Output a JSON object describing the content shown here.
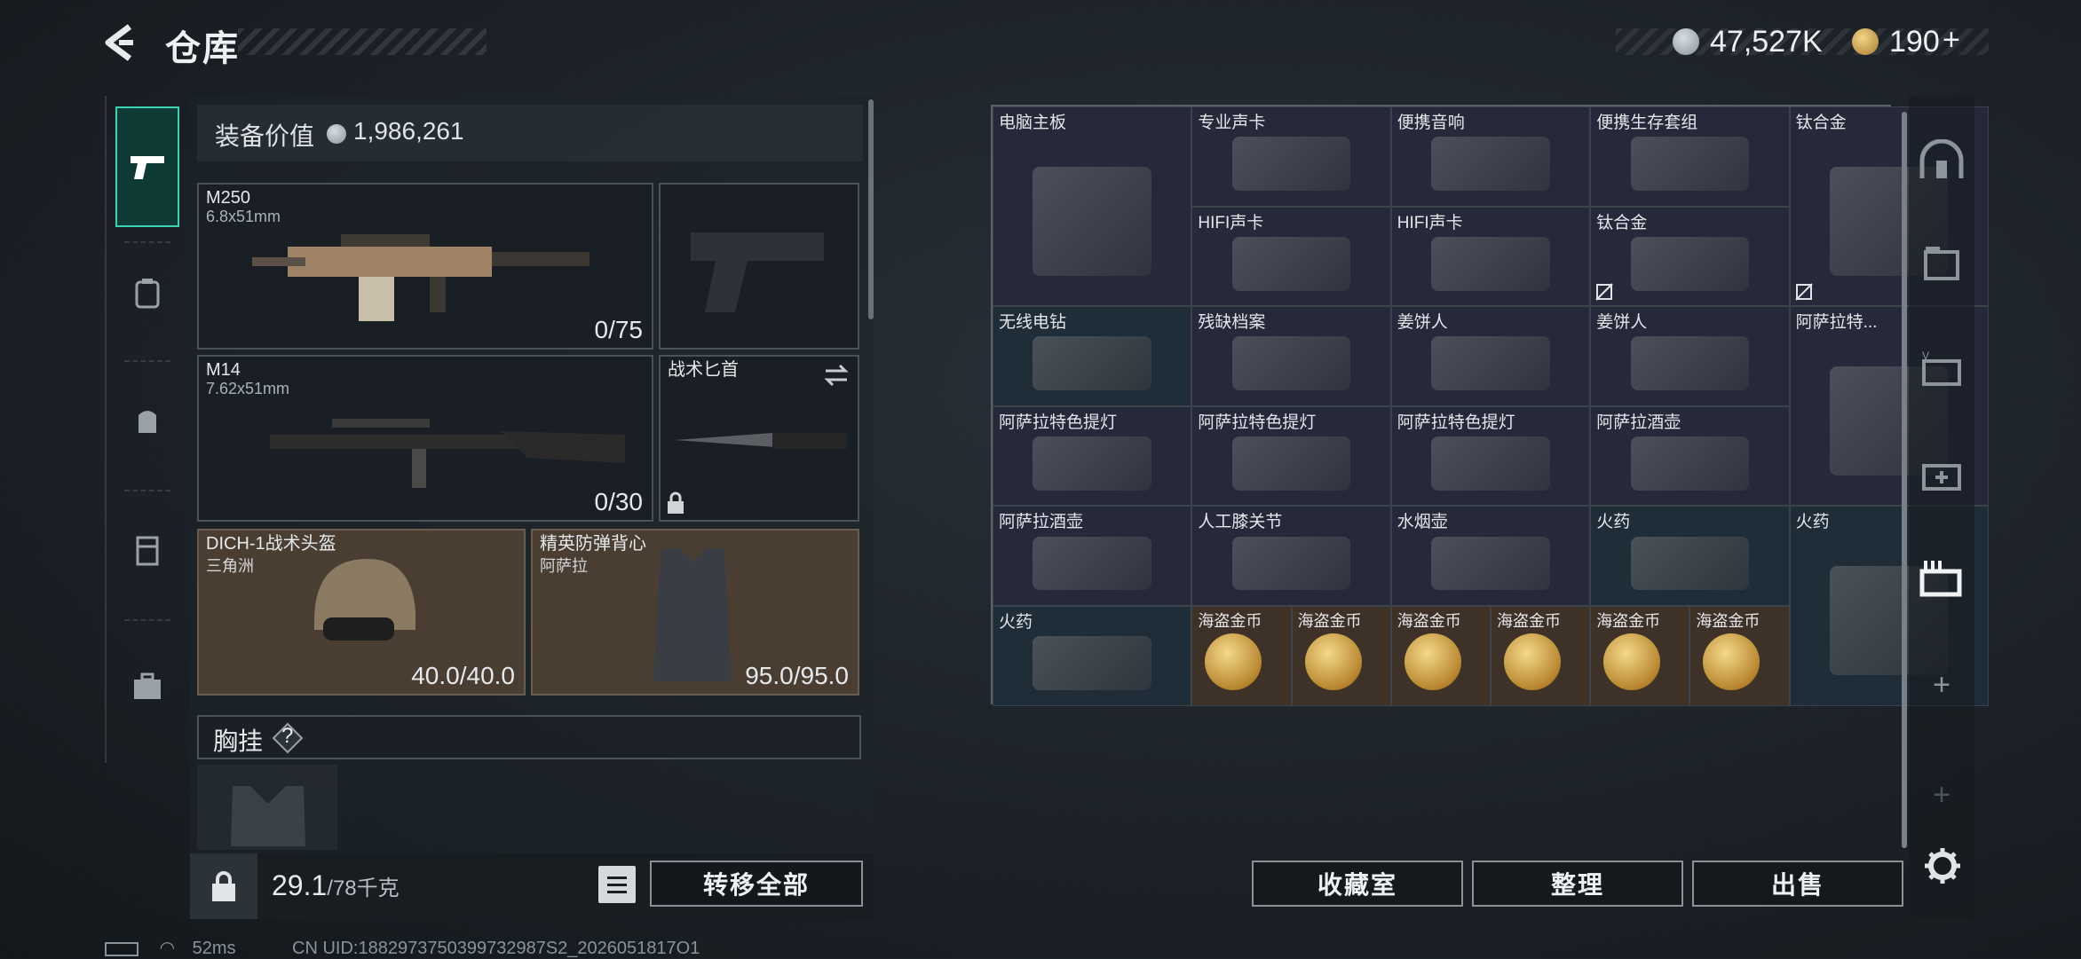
{
  "header": {
    "title": "仓库",
    "currency1": "47,527K",
    "currency2": "190",
    "add_symbol": "+"
  },
  "loadout": {
    "value_label": "装备价值",
    "value": "1,986,261",
    "primary": {
      "name": "M250",
      "caliber": "6.8x51mm",
      "ammo": "0/75"
    },
    "secondary": {
      "name": "M14",
      "caliber": "7.62x51mm",
      "ammo": "0/30"
    },
    "melee": {
      "name": "战术匕首"
    },
    "helmet": {
      "name": "DICH-1战术头盔",
      "map": "三角洲",
      "durability": "40.0/40.0"
    },
    "armor": {
      "name": "精英防弹背心",
      "map": "阿萨拉",
      "durability": "95.0/95.0"
    },
    "chest_label": "胸挂",
    "help_symbol": "?",
    "weight": "29.1",
    "weight_max": "/78千克",
    "transfer_all": "转移全部"
  },
  "storage": {
    "items": [
      {
        "label": "电脑主板",
        "color": "dark"
      },
      {
        "label": "专业声卡",
        "color": "dark"
      },
      {
        "label": "便携音响",
        "color": "dark"
      },
      {
        "label": "便携生存套组",
        "color": "dark"
      },
      {
        "label": "钛合金",
        "color": "dark"
      },
      {
        "label": "HIFI声卡",
        "color": "dark"
      },
      {
        "label": "HIFI声卡",
        "color": "dark"
      },
      {
        "label": "钛合金",
        "color": "dark"
      },
      {
        "label": "无线电钻",
        "color": "teal"
      },
      {
        "label": "残缺档案",
        "color": "dark"
      },
      {
        "label": "姜饼人",
        "color": "dark"
      },
      {
        "label": "姜饼人",
        "color": "dark"
      },
      {
        "label": "阿萨拉特...",
        "color": "dark"
      },
      {
        "label": "阿萨拉特色提灯",
        "color": "dark"
      },
      {
        "label": "阿萨拉特色提灯",
        "color": "dark"
      },
      {
        "label": "阿萨拉特色提灯",
        "color": "dark"
      },
      {
        "label": "阿萨拉酒壶",
        "color": "dark"
      },
      {
        "label": "阿萨拉酒壶",
        "color": "dark"
      },
      {
        "label": "人工膝关节",
        "color": "dark"
      },
      {
        "label": "水烟壶",
        "color": "dark"
      },
      {
        "label": "火药",
        "color": "teal"
      },
      {
        "label": "火药",
        "color": "teal"
      },
      {
        "label": "火药",
        "color": "teal"
      },
      {
        "label": "海盗金币",
        "color": "brown"
      },
      {
        "label": "海盗金币",
        "color": "brown"
      },
      {
        "label": "海盗金币",
        "color": "brown"
      },
      {
        "label": "海盗金币",
        "color": "brown"
      },
      {
        "label": "海盗金币",
        "color": "brown"
      },
      {
        "label": "海盗金币",
        "color": "brown"
      }
    ]
  },
  "actions": {
    "collection": "收藏室",
    "sort": "整理",
    "sell": "出售"
  },
  "right_rail": {
    "add_symbol": "+"
  },
  "status": {
    "ping": "52ms",
    "uid": "CN UID:1882973750399732987S2_2026051817O1"
  },
  "colors": {
    "accent": "#38d3b3",
    "panel": "#1e242a",
    "item_dark": "#26293a",
    "item_teal": "#1f2d38",
    "item_brown": "#3e3128"
  }
}
